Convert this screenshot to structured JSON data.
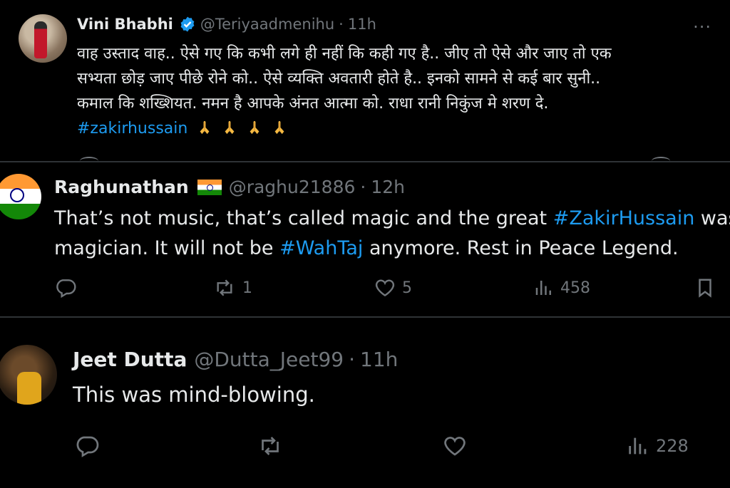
{
  "tweets": [
    {
      "name": "Vini Bhabhi",
      "handle": "@Teriyaadmenihu",
      "dot": "·",
      "time": "11h",
      "more": "···",
      "lines": [
        "वाह उस्ताद वाह.. ऐसे गए कि कभी लगे ही नहीं कि कही गए है.. जीए तो ऐसे और जाए तो एक",
        "सभ्यता छोड़ जाए पीछे रोने को.. ऐसे व्यक्ति अवतारी होते है.. इनको सामने से कई बार सुनी..",
        "कमाल कि शख्शियत. नमन है आपके अंनत आत्मा को. राधा रानी निकुंज मे शरण दे."
      ],
      "hashtag": "#zakirhussain",
      "icons": {
        "verified": "verified-badge-icon",
        "pray": "folded-hands-icon"
      },
      "colors": {
        "link": "#1d9bf0",
        "verified": "#1d9bf0"
      }
    },
    {
      "name": "Raghunathan",
      "handle": "@raghu21886",
      "dot": "·",
      "time": "12h",
      "line1_pre": "That’s not music, that’s called magic and the great ",
      "line1_tag": "#ZakirHussain",
      "line1_post": " was a",
      "line2_pre": "magician. It will not be ",
      "line2_tag": "#WahTaj",
      "line2_post": " anymore. Rest in Peace Legend.",
      "stats": {
        "replies": "",
        "retweets": "1",
        "likes": "5",
        "views": "458"
      }
    },
    {
      "name": "Jeet Dutta",
      "handle": "@Dutta_Jeet99",
      "dot": "·",
      "time": "11h",
      "text": "This was mind-blowing.",
      "stats": {
        "replies": "",
        "retweets": "",
        "likes": "",
        "views": "228"
      }
    }
  ]
}
